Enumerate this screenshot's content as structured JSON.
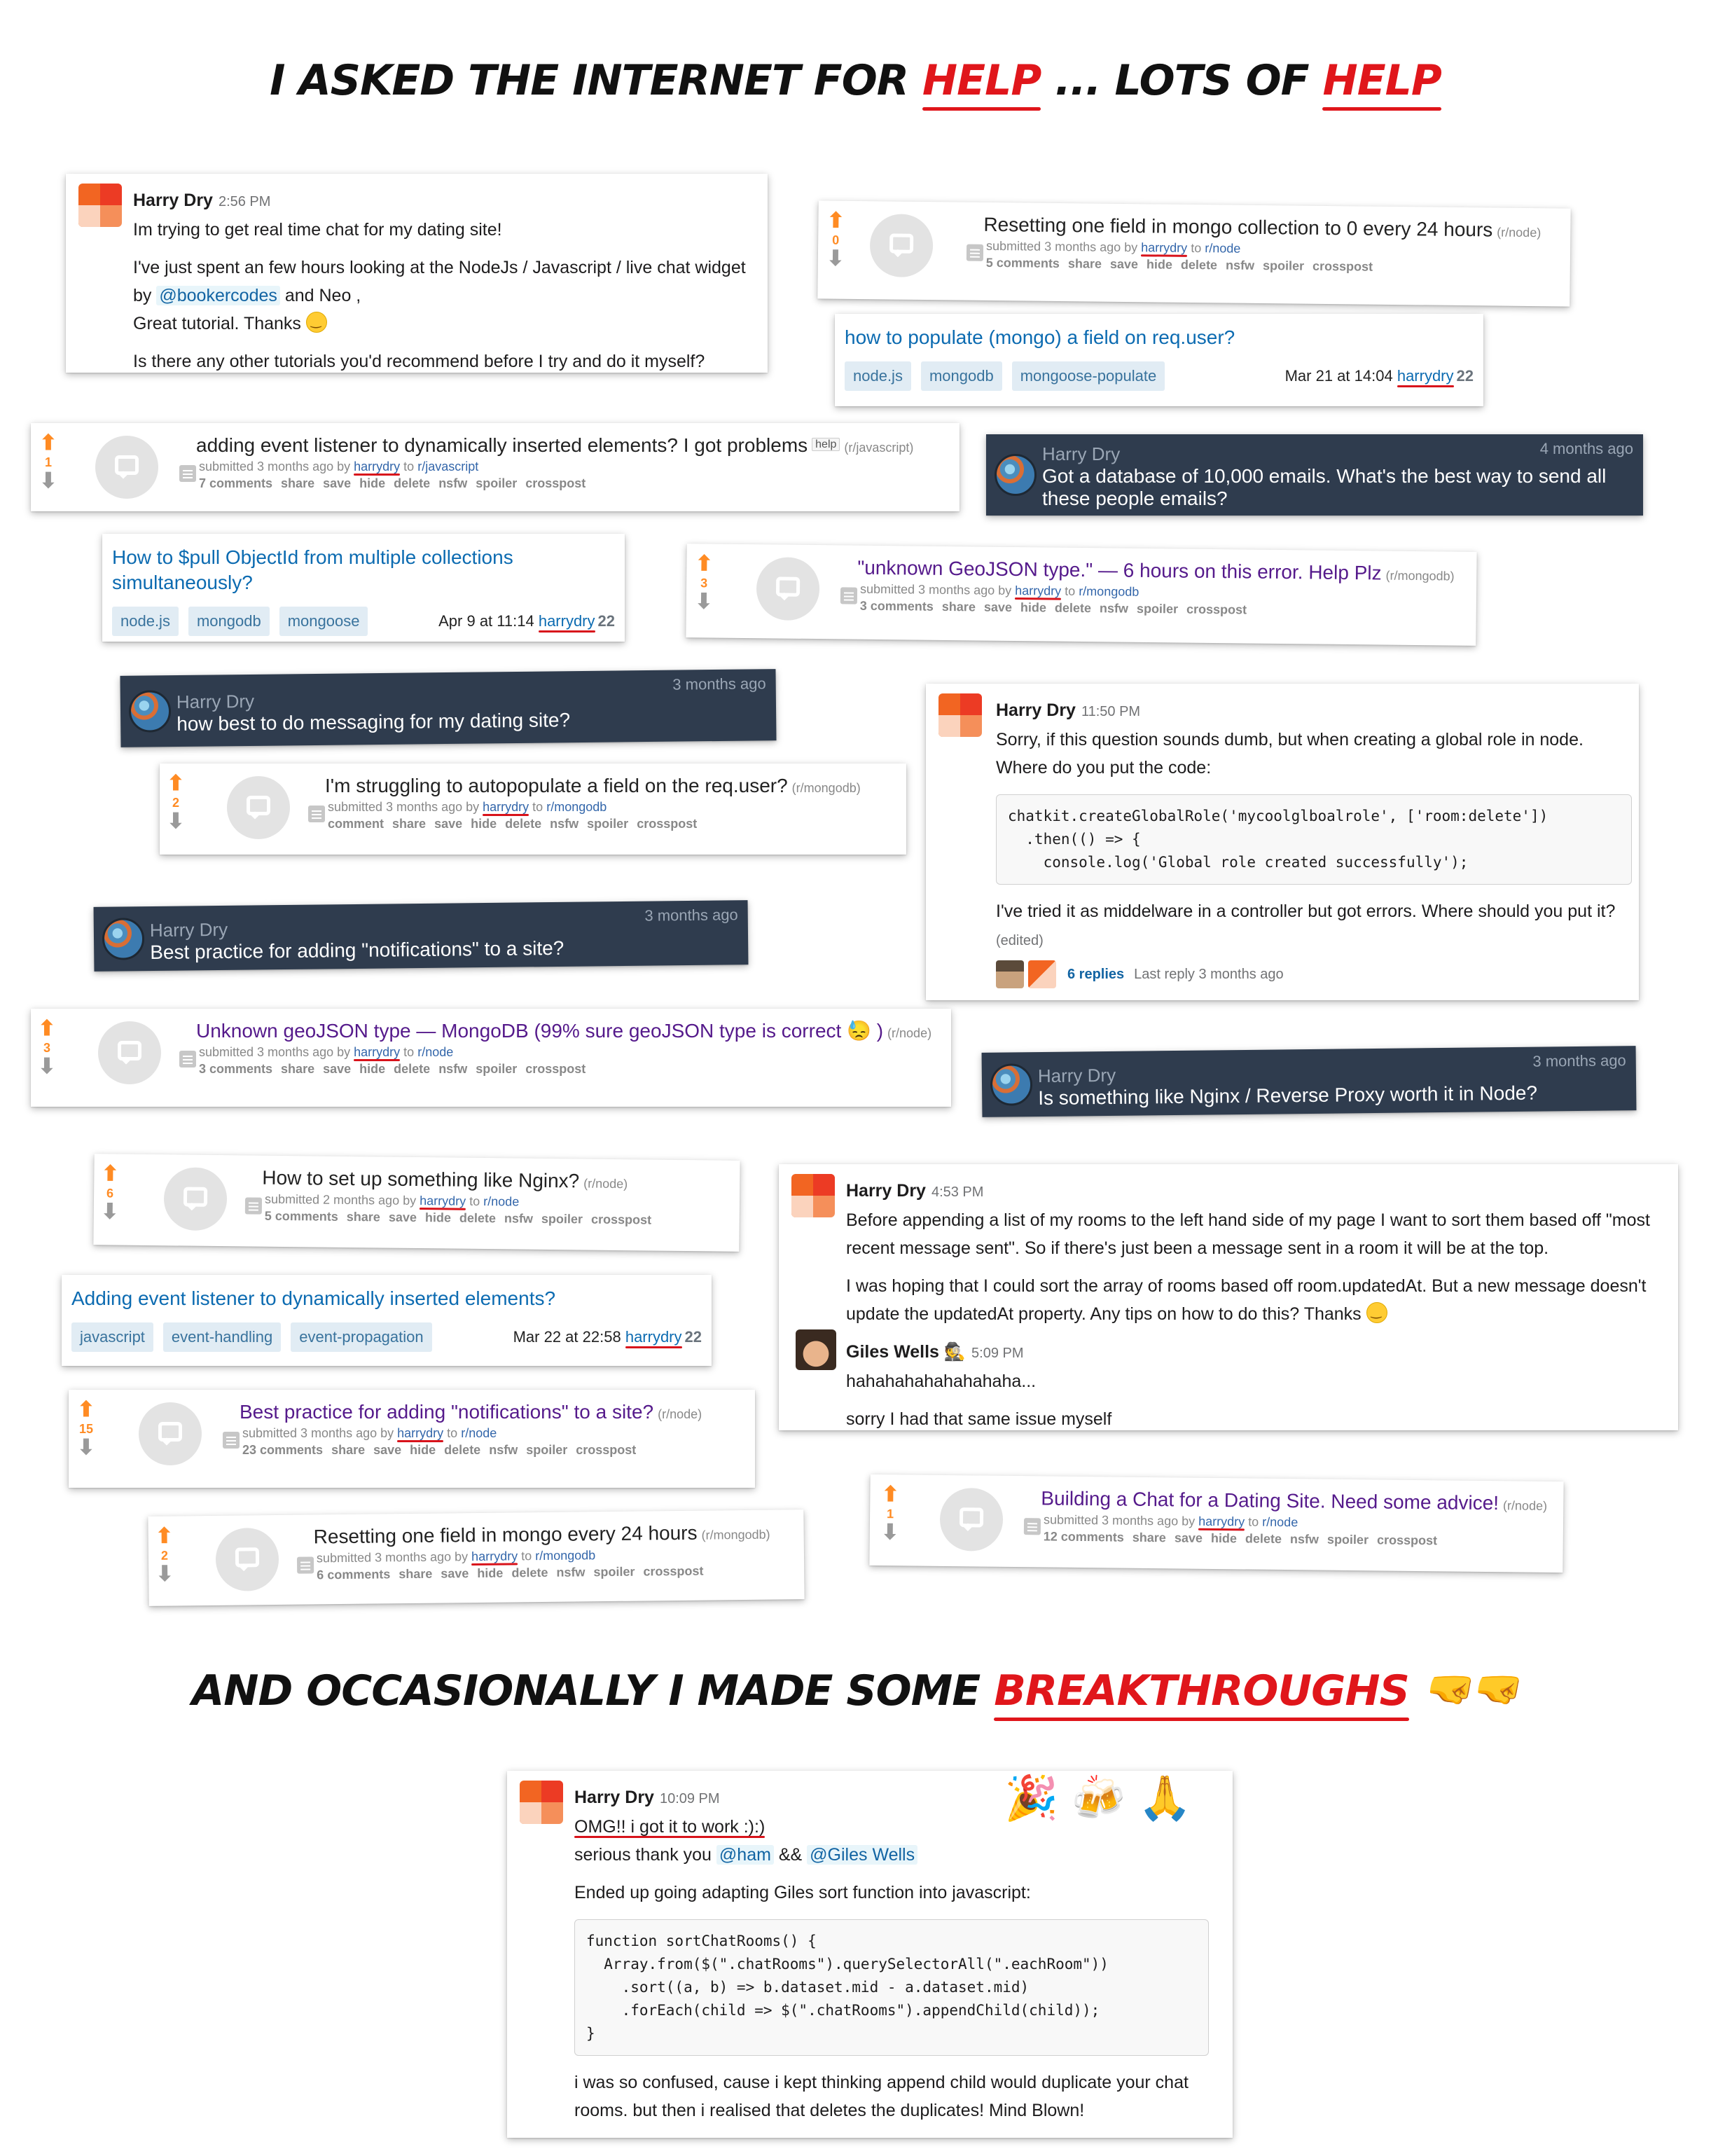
{
  "headline_top": {
    "pre": "I ASKED THE INTERNET FOR ",
    "red1": "HELP",
    "mid": " ...  LOTS OF ",
    "red2": "HELP"
  },
  "headline_bottom": {
    "pre": "AND OCCASIONALLY I MADE SOME ",
    "red": "BREAKTHROUGHS",
    "emoji": "🤜🤜"
  },
  "slack1": {
    "name": "Harry Dry",
    "time": "2:56 PM",
    "p1": "Im trying to get real time chat for my dating site!",
    "p2a": "I've just spent an few hours looking at the NodeJs /  Javascript /  live chat widget by ",
    "p2_mention": "@bookercodes",
    "p2b": " and Neo ,",
    "p2c": "Great tutorial. Thanks ",
    "p3": "Is there any other tutorials you'd recommend before I try and do it myself?"
  },
  "reddit_posts": [
    {
      "score": "0",
      "title": "Resetting one field in mongo collection to 0 every 24 hours",
      "domain": "(r/node)",
      "submitted": "submitted 3 months ago by",
      "user": "harrydry",
      "to": "to",
      "sub": "r/node",
      "comments": "5 comments"
    },
    {
      "score": "1",
      "title": "adding event listener to dynamically inserted elements? I got problems",
      "flair": "help",
      "domain": "(r/javascript)",
      "submitted": "submitted 3 months ago by",
      "user": "harrydry",
      "to": "to",
      "sub": "r/javascript",
      "comments": "7 comments"
    },
    {
      "score": "3",
      "title": "\"unknown GeoJSON type.\" — 6 hours on this error. Help Plz",
      "domain": "(r/mongodb)",
      "submitted": "submitted 3 months ago by",
      "user": "harrydry",
      "to": "to",
      "sub": "r/mongodb",
      "comments": "3 comments"
    },
    {
      "score": "2",
      "title": "I'm struggling to autopopulate a field on the req.user?",
      "domain": "(r/mongodb)",
      "submitted": "submitted 3 months ago by",
      "user": "harrydry",
      "to": "to",
      "sub": "r/mongodb",
      "comments": "comment"
    },
    {
      "score": "3",
      "title": "Unknown geoJSON type — MongoDB (99% sure geoJSON type is correct 😓 )",
      "domain": "(r/node)",
      "submitted": "submitted 3 months ago by",
      "user": "harrydry",
      "to": "to",
      "sub": "r/node",
      "comments": "3 comments"
    },
    {
      "score": "6",
      "title": "How to set up something like Nginx?",
      "domain": "(r/node)",
      "submitted": "submitted 2 months ago by",
      "user": "harrydry",
      "to": "to",
      "sub": "r/node",
      "comments": "5 comments"
    },
    {
      "score": "15",
      "title": "Best practice for adding \"notifications\" to a site?",
      "domain": "(r/node)",
      "submitted": "submitted 3 months ago by",
      "user": "harrydry",
      "to": "to",
      "sub": "r/node",
      "comments": "23 comments"
    },
    {
      "score": "2",
      "title": "Resetting one field in mongo every 24 hours",
      "domain": "(r/mongodb)",
      "submitted": "submitted 3 months ago by",
      "user": "harrydry",
      "to": "to",
      "sub": "r/mongodb",
      "comments": "6 comments"
    },
    {
      "score": "1",
      "title": "Building a Chat for a Dating Site. Need some advice!",
      "domain": "(r/node)",
      "submitted": "submitted 3 months ago by",
      "user": "harrydry",
      "to": "to",
      "sub": "r/node",
      "comments": "12 comments"
    }
  ],
  "reddit_buttons": [
    "share",
    "save",
    "hide",
    "delete",
    "nsfw",
    "spoiler",
    "crosspost"
  ],
  "so_posts": [
    {
      "title": "how to populate (mongo) a field on req.user?",
      "tags": [
        "node.js",
        "mongodb",
        "mongoose-populate"
      ],
      "date": "Mar 21 at 14:04",
      "user": "harrydry",
      "rep": "22"
    },
    {
      "title": "How to $pull ObjectId from multiple collections simultaneously?",
      "tags": [
        "node.js",
        "mongodb",
        "mongoose"
      ],
      "date": "Apr 9 at 11:14",
      "user": "harrydry",
      "rep": "22"
    },
    {
      "title": "Adding event listener to dynamically inserted elements?",
      "tags": [
        "javascript",
        "event-handling",
        "event-propagation"
      ],
      "date": "Mar 22 at 22:58",
      "user": "harrydry",
      "rep": "22"
    }
  ],
  "dark_msgs": [
    {
      "name": "Harry Dry",
      "ago": "4 months ago",
      "msg": "Got a database of 10,000 emails. What's the best way to send all these people emails?"
    },
    {
      "name": "Harry Dry",
      "ago": "3 months ago",
      "msg": "how best to do messaging for my dating site?"
    },
    {
      "name": "Harry Dry",
      "ago": "3 months ago",
      "msg": "Best practice for adding \"notifications\" to a site?"
    },
    {
      "name": "Harry Dry",
      "ago": "3 months ago",
      "msg": "Is something like Nginx / Reverse Proxy worth it in Node?"
    }
  ],
  "slack2": {
    "name": "Harry Dry",
    "time": "11:50 PM",
    "p1": "Sorry, if this question sounds dumb, but when creating a global role in node. Where do you put the code:",
    "code": "chatkit.createGlobalRole('mycoolglboalrole', ['room:delete'])\n  .then(() => {\n    console.log('Global role created successfully');",
    "p2": "I've tried it as middelware in a controller but got errors. Where should you put it?",
    "edited": "(edited)",
    "replies": "6 replies",
    "last_reply": "Last reply 3 months ago"
  },
  "slack3": {
    "name": "Harry Dry",
    "time": "4:53 PM",
    "p1": "Before appending a list of my rooms to the left hand side of my page I want to sort them based off \"most recent message sent\". So if there's just been a message sent in a room it will be at the top.",
    "p2": "I was hoping that I could sort the array of rooms based off room.updatedAt. But a new message doesn't update the updatedAt property. Any tips on how to do this? Thanks ",
    "reply_name": "Giles Wells",
    "reply_badge": "🕵",
    "reply_time": "5:09 PM",
    "reply_p1": "hahahahahahahahaha...",
    "reply_p2": "sorry I had that same issue myself"
  },
  "slack4": {
    "name": "Harry Dry",
    "time": "10:09 PM",
    "p1": "OMG!! i got it to work :):)",
    "p2a": "serious thank you ",
    "mention1": "@ham",
    "p2b": " && ",
    "mention2": "@Giles Wells",
    "emojis": "🎉🍻🙏",
    "p3": "Ended up going adapting Giles sort function into javascript:",
    "code": "function sortChatRooms() {\n  Array.from($(\".chatRooms\").querySelectorAll(\".eachRoom\"))\n    .sort((a, b) => b.dataset.mid - a.dataset.mid)\n    .forEach(child => $(\".chatRooms\").appendChild(child));\n}",
    "p4": "i was so confused, cause i kept thinking append child would duplicate your chat rooms. but then i realised that deletes the duplicates! Mind Blown!"
  }
}
